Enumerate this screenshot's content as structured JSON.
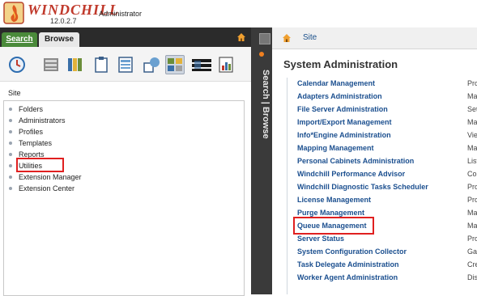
{
  "header": {
    "logo_text": "WINDCHILL",
    "version": "12.0.2.7",
    "role": "Administrator"
  },
  "left": {
    "tabs": [
      {
        "label": "Search"
      },
      {
        "label": "Browse"
      }
    ],
    "site_label": "Site",
    "tree": [
      "Folders",
      "Administrators",
      "Profiles",
      "Templates",
      "Reports",
      "Utilities",
      "Extension Manager",
      "Extension Center"
    ]
  },
  "vertical_tabs": "Search | Browse",
  "right": {
    "breadcrumb": "Site",
    "title": "System Administration",
    "rows": [
      {
        "name": "Calendar Management",
        "desc": "Pro"
      },
      {
        "name": "Adapters Administration",
        "desc": "Ma"
      },
      {
        "name": "File Server Administration",
        "desc": "Set"
      },
      {
        "name": "Import/Export Management",
        "desc": "Ma"
      },
      {
        "name": "Info*Engine Administration",
        "desc": "Vie"
      },
      {
        "name": "Mapping Management",
        "desc": "Ma"
      },
      {
        "name": "Personal Cabinets Administration",
        "desc": "List"
      },
      {
        "name": "Windchill Performance Advisor",
        "desc": "Cor"
      },
      {
        "name": "Windchill Diagnostic Tasks Scheduler",
        "desc": "Pro"
      },
      {
        "name": "License Management",
        "desc": "Pro"
      },
      {
        "name": "Purge Management",
        "desc": "Ma"
      },
      {
        "name": "Queue Management",
        "desc": "Ma"
      },
      {
        "name": "Server Status",
        "desc": "Pro"
      },
      {
        "name": "System Configuration Collector",
        "desc": "Gat"
      },
      {
        "name": "Task Delegate Administration",
        "desc": "Cre"
      },
      {
        "name": "Worker Agent Administration",
        "desc": "Dis"
      }
    ]
  }
}
